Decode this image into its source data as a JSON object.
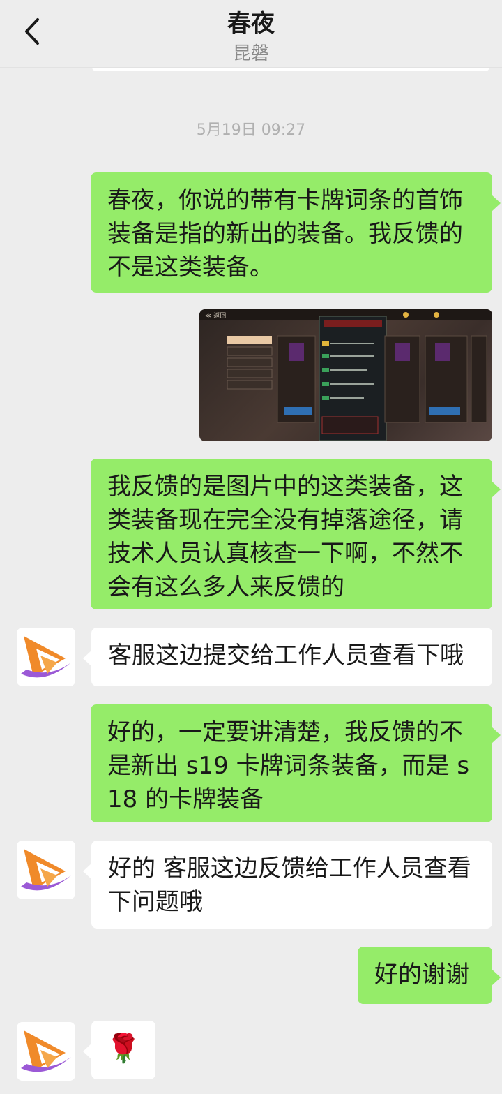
{
  "header": {
    "title": "春夜",
    "subtitle": "昆磐"
  },
  "timestamp": "5月19日 09:27",
  "messages": [
    {
      "side": "out",
      "text": "春夜，你说的带有卡牌词条的首饰装备是指的新出的装备。我反馈的不是这类装备。"
    },
    {
      "side": "out",
      "type": "image"
    },
    {
      "side": "out",
      "text": "我反馈的是图片中的这类装备，这类装备现在完全没有掉落途径，请技术人员认真核查一下啊，不然不会有这么多人来反馈的"
    },
    {
      "side": "in",
      "text": "客服这边提交给工作人员查看下哦"
    },
    {
      "side": "out",
      "text": "好的，一定要讲清楚，我反馈的不是新出 s19 卡牌词条装备，而是 s18 的卡牌装备"
    },
    {
      "side": "in",
      "text": "好的 客服这边反馈给工作人员查看下问题哦"
    },
    {
      "side": "out",
      "text": "好的谢谢"
    },
    {
      "side": "in",
      "text": "🌹"
    }
  ],
  "colors": {
    "background": "#ededed",
    "outgoing_bubble": "#95ec69",
    "incoming_bubble": "#ffffff",
    "avatar_orange": "#f08a2a",
    "avatar_purple": "#9b59d6"
  },
  "icons": {
    "back": "chevron-left-icon",
    "avatar": "service-logo-icon"
  }
}
